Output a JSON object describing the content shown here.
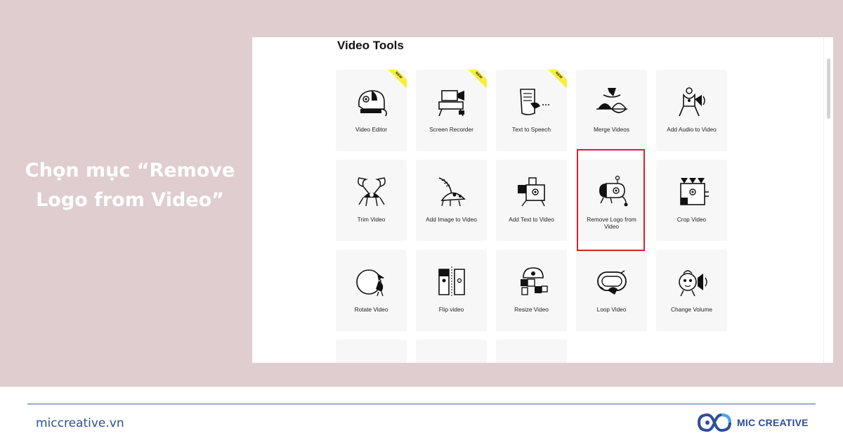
{
  "caption": {
    "line1": "Chọn mục “Remove",
    "line2": "Logo from Video”"
  },
  "screenshot": {
    "section_title": "Video Tools",
    "badge_label": "NEW",
    "tools": [
      {
        "label": "Video Editor",
        "icon": "chameleon-icon",
        "badge": true
      },
      {
        "label": "Screen Recorder",
        "icon": "camera-rig-icon",
        "badge": true
      },
      {
        "label": "Text to Speech",
        "icon": "scroll-bird-icon",
        "badge": true
      },
      {
        "label": "Merge Videos",
        "icon": "merge-flamingo-icon",
        "badge": false
      },
      {
        "label": "Add Audio to Video",
        "icon": "audio-figure-icon",
        "badge": false
      },
      {
        "label": "Trim Video",
        "icon": "crab-icon",
        "badge": false
      },
      {
        "label": "Add Image to Video",
        "icon": "feather-bug-icon",
        "badge": false
      },
      {
        "label": "Add Text to Video",
        "icon": "text-box-icon",
        "badge": false
      },
      {
        "label": "Remove Logo from Video",
        "icon": "capsule-face-icon",
        "badge": false,
        "highlighted": true
      },
      {
        "label": "Crop Video",
        "icon": "crop-face-icon",
        "badge": false
      },
      {
        "label": "Rotate Video",
        "icon": "circle-bird-icon",
        "badge": false
      },
      {
        "label": "Flip video",
        "icon": "mirror-faces-icon",
        "badge": false
      },
      {
        "label": "Resize Video",
        "icon": "blocks-robot-icon",
        "badge": false
      },
      {
        "label": "Loop Video",
        "icon": "loop-ring-icon",
        "badge": false
      },
      {
        "label": "Change Volume",
        "icon": "speaker-face-icon",
        "badge": false
      },
      {
        "label": "",
        "icon": "partial-icon",
        "badge": false
      },
      {
        "label": "",
        "icon": "partial-icon",
        "badge": false
      },
      {
        "label": "",
        "icon": "partial-icon",
        "badge": false
      }
    ]
  },
  "footer": {
    "website": "miccreative.vn",
    "brand": "MIC CREATIVE"
  },
  "colors": {
    "band": "#dfcdd0",
    "accent": "#2e4d9c",
    "highlight": "#d9222a",
    "card": "#f7f7f8",
    "badge": "#f6ef3c"
  }
}
